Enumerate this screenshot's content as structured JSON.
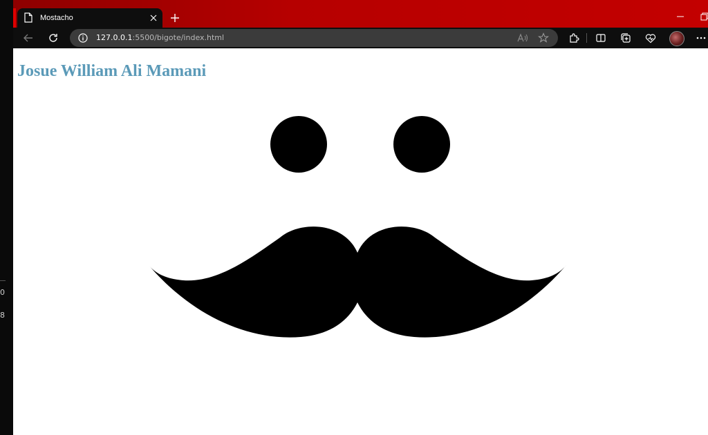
{
  "tab": {
    "title": "Mostacho"
  },
  "address_bar": {
    "host": "127.0.0.1",
    "path": ":5500/bigote/index.html"
  },
  "page": {
    "heading": "Josue William Ali Mamani"
  },
  "colors": {
    "tab_bar": "#b60000",
    "heading": "#5b9ab8",
    "page_bg": "#ffffff",
    "shapes": "#000000"
  },
  "left_strip": {
    "glyph_top": "0",
    "glyph_bottom": "8"
  }
}
